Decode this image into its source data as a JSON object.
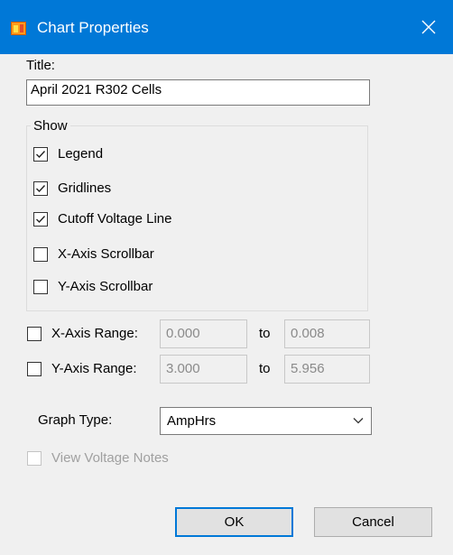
{
  "window": {
    "title": "Chart Properties",
    "app_icon": "chart-app-icon",
    "close_icon": "close-icon"
  },
  "title_field": {
    "label": "Title:",
    "value": "April 2021 R302 Cells"
  },
  "show_group": {
    "title": "Show",
    "options": [
      {
        "label": "Legend",
        "checked": true
      },
      {
        "label": "Gridlines",
        "checked": true
      },
      {
        "label": "Cutoff Voltage Line",
        "checked": true
      },
      {
        "label": "X-Axis Scrollbar",
        "checked": false
      },
      {
        "label": "Y-Axis Scrollbar",
        "checked": false
      }
    ]
  },
  "x_range": {
    "label": "X-Axis Range:",
    "checked": false,
    "min": "0.000",
    "to_label": "to",
    "max": "0.008"
  },
  "y_range": {
    "label": "Y-Axis Range:",
    "checked": false,
    "min": "3.000",
    "to_label": "to",
    "max": "5.956"
  },
  "graph_type": {
    "label": "Graph Type:",
    "value": "AmpHrs",
    "dropdown_icon": "chevron-down-icon"
  },
  "view_voltage_notes": {
    "label": "View Voltage Notes",
    "checked": false,
    "enabled": false
  },
  "buttons": {
    "ok": "OK",
    "cancel": "Cancel"
  },
  "colors": {
    "titlebar": "#0078d7",
    "default_button_border": "#0078d7"
  }
}
